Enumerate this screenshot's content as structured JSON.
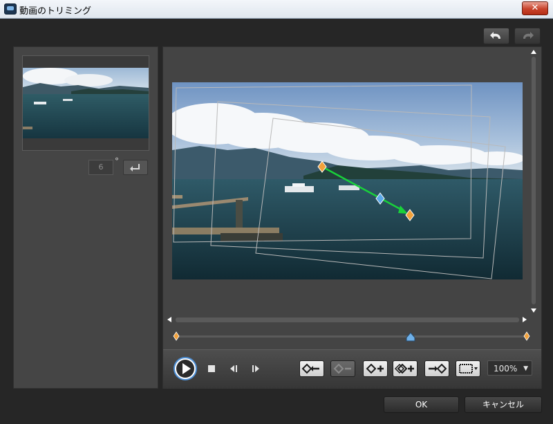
{
  "window": {
    "title": "動画のトリミング",
    "close_label": "✕"
  },
  "toolbar": {
    "undo_icon": "undo-icon",
    "redo_icon": "redo-icon"
  },
  "rotation": {
    "angle_value": "6",
    "degree_symbol": "°"
  },
  "playback": {
    "zoom_value": "100%"
  },
  "dialog_buttons": {
    "ok_label": "OK",
    "cancel_label": "キャンセル"
  },
  "colors": {
    "accent_arrow": "#19d23a",
    "keyframe": "#f2a13a",
    "keyframe_mid": "#5ba8e8"
  }
}
